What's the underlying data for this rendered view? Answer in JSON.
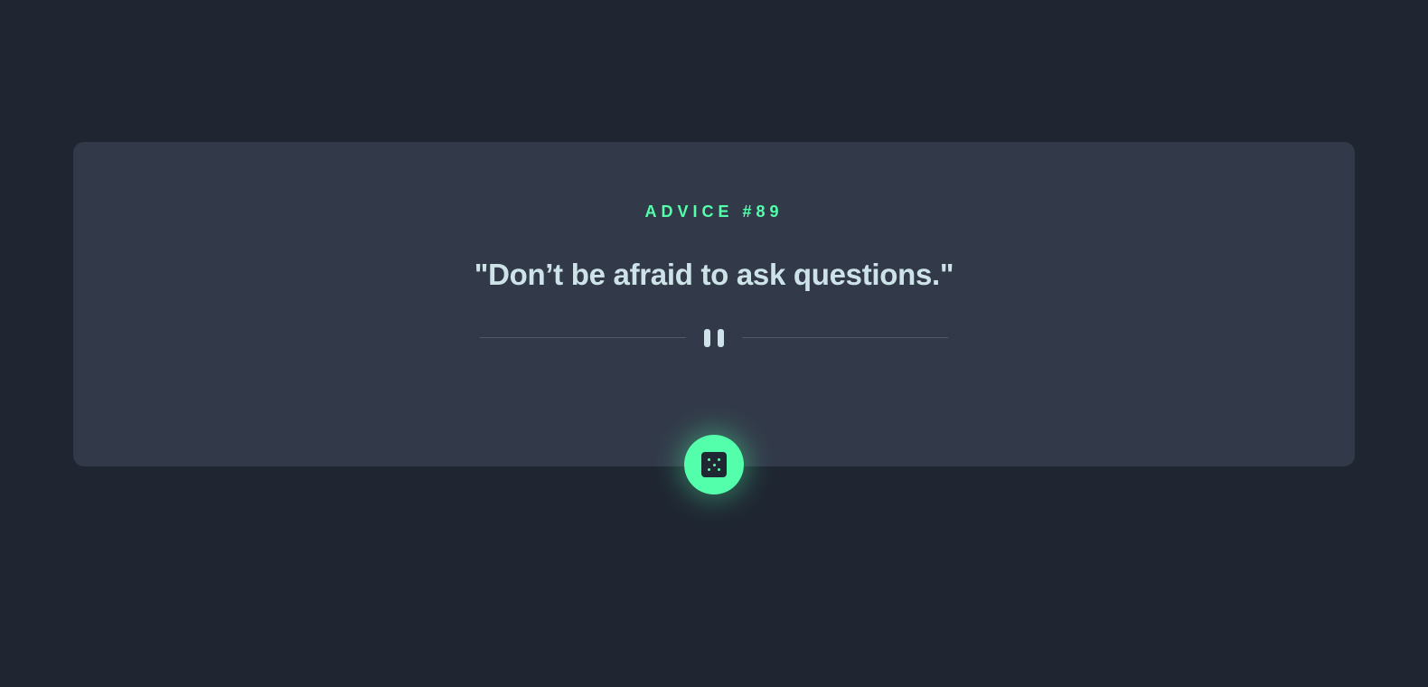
{
  "advice": {
    "label": "ADVICE #89",
    "quote": "\"Don’t be afraid to ask questions.\""
  },
  "colors": {
    "background": "#1f2632",
    "card": "#323a49",
    "accent": "#53ffaa",
    "text": "#cee3e9"
  },
  "icons": {
    "divider": "pause-icon",
    "button": "dice-icon"
  }
}
